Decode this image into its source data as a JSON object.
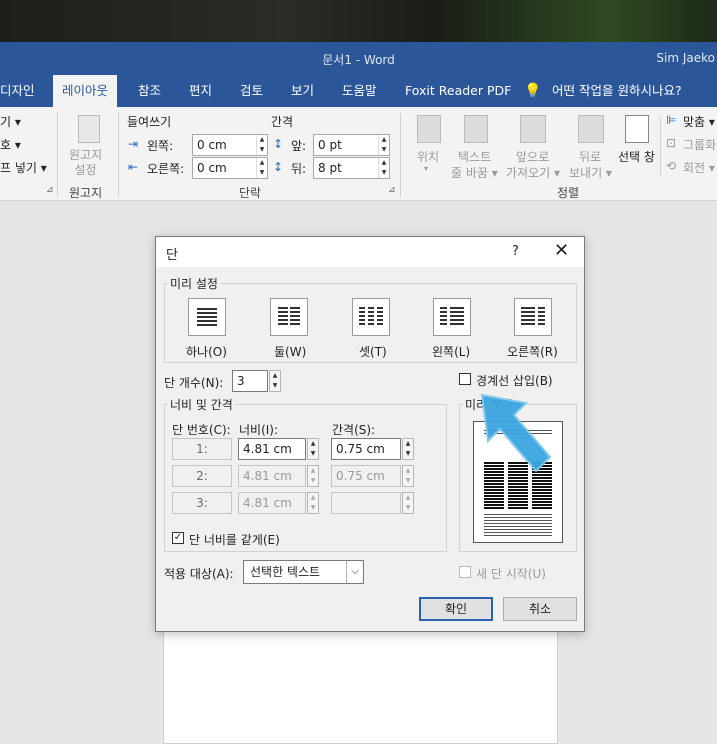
{
  "titlebar": {
    "doc_title": "문서1  -  Word",
    "user": "Sim Jaeko"
  },
  "tabs": [
    {
      "label": "디자인"
    },
    {
      "label": "레이아웃"
    },
    {
      "label": "참조"
    },
    {
      "label": "편지"
    },
    {
      "label": "검토"
    },
    {
      "label": "보기"
    },
    {
      "label": "도움말"
    },
    {
      "label": "Foxit Reader PDF"
    },
    {
      "label": "어떤 작업을 원하시나요?"
    }
  ],
  "ribbon": {
    "left_cut": [
      "기 ▾",
      "호 ▾",
      "프 넣기 ▾"
    ],
    "manuscript": {
      "button": "원고지\n설정",
      "group": "원고지"
    },
    "indent": {
      "header": "들여쓰기",
      "left_label": "왼쪽:",
      "left_value": "0 cm",
      "right_label": "오른쪽:",
      "right_value": "0 cm"
    },
    "spacing": {
      "header": "간격",
      "before_label": "앞:",
      "before_value": "0 pt",
      "after_label": "뒤:",
      "after_value": "8 pt"
    },
    "paragraph_group": "단락",
    "arrange": {
      "position": "위치",
      "wrap1": "텍스트",
      "wrap2": "줄 바꿈 ▾",
      "forward1": "앞으로",
      "forward2": "가져오기 ▾",
      "backward1": "뒤로",
      "backward2": "보내기 ▾",
      "selection_pane": "선택 창",
      "align": "맞춤 ▾",
      "group_btn": "그룹화",
      "rotate": "회전 ▾",
      "group": "정렬"
    }
  },
  "dialog": {
    "title": "단",
    "help": "?",
    "close": "✕",
    "presets_label": "미리 설정",
    "presets": [
      {
        "label": "하나(O)"
      },
      {
        "label": "둘(W)"
      },
      {
        "label": "셋(T)"
      },
      {
        "label": "왼쪽(L)"
      },
      {
        "label": "오른쪽(R)"
      }
    ],
    "num_columns_label": "단 개수(N):",
    "num_columns_value": "3",
    "line_between_label": "경계선 삽입(B)",
    "width_spacing_label": "너비 및 간격",
    "col_header": "단 번호(C):",
    "width_header": "너비(I):",
    "spacing_header": "간격(S):",
    "rows": [
      {
        "num": "1:",
        "width": "4.81 cm",
        "spacing": "0.75 cm"
      },
      {
        "num": "2:",
        "width": "4.81 cm",
        "spacing": "0.75 cm"
      },
      {
        "num": "3:",
        "width": "4.81 cm",
        "spacing": ""
      }
    ],
    "equal_width_label": "단 너비를 같게(E)",
    "preview_label": "미리 보기",
    "apply_to_label": "적용 대상(A):",
    "apply_to_value": "선택한 텍스트",
    "new_column_label": "새 단 시작(U)",
    "ok": "확인",
    "cancel": "취소"
  },
  "colors": {
    "accent": "#2b579a",
    "arrow": "#3aa6e0"
  }
}
